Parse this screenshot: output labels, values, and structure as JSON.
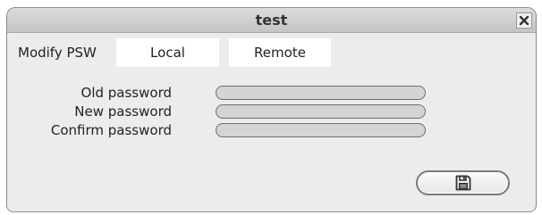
{
  "dialog": {
    "title": "test",
    "close_icon": "close-icon"
  },
  "tabs": {
    "section_label": "Modify PSW",
    "items": [
      {
        "label": "Local"
      },
      {
        "label": "Remote"
      }
    ]
  },
  "form": {
    "old_password_label": "Old password",
    "new_password_label": "New password",
    "confirm_password_label": "Confirm password",
    "old_password_value": "",
    "new_password_value": "",
    "confirm_password_value": ""
  },
  "actions": {
    "save_icon": "save-icon"
  }
}
